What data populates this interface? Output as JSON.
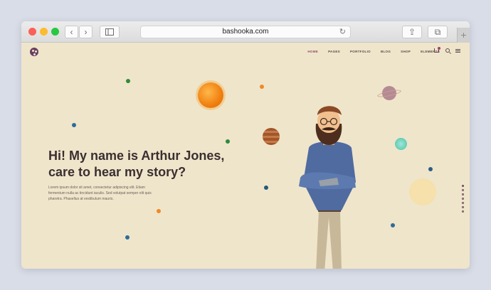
{
  "browser": {
    "url": "bashooka.com",
    "back_icon": "‹",
    "forward_icon": "›",
    "reload_icon": "↻",
    "share_icon": "⇪",
    "tabs_icon": "⧉",
    "newtab_icon": "+"
  },
  "site": {
    "nav": {
      "home": "HOME",
      "pages": "PAGES",
      "portfolio": "PORTFOLIO",
      "blog": "BLOG",
      "shop": "SHOP",
      "elements": "ELEMENTS"
    },
    "hero": {
      "title_line1": "Hi! My name is Arthur Jones,",
      "title_line2": "care to hear my story?",
      "text": "Lorem ipsum dolor sit amet, consectetur adipiscing elit. Etiam fermentum nulla ac tincidunt iaculis. Sed volutpat semper elit quis pharetra. Phasellus at vestibulum mauris."
    },
    "scroll_arrow": "↓"
  },
  "colors": {
    "background": "#efe5cb",
    "heading": "#3b2f2f",
    "accent": "#8a4d6b"
  }
}
